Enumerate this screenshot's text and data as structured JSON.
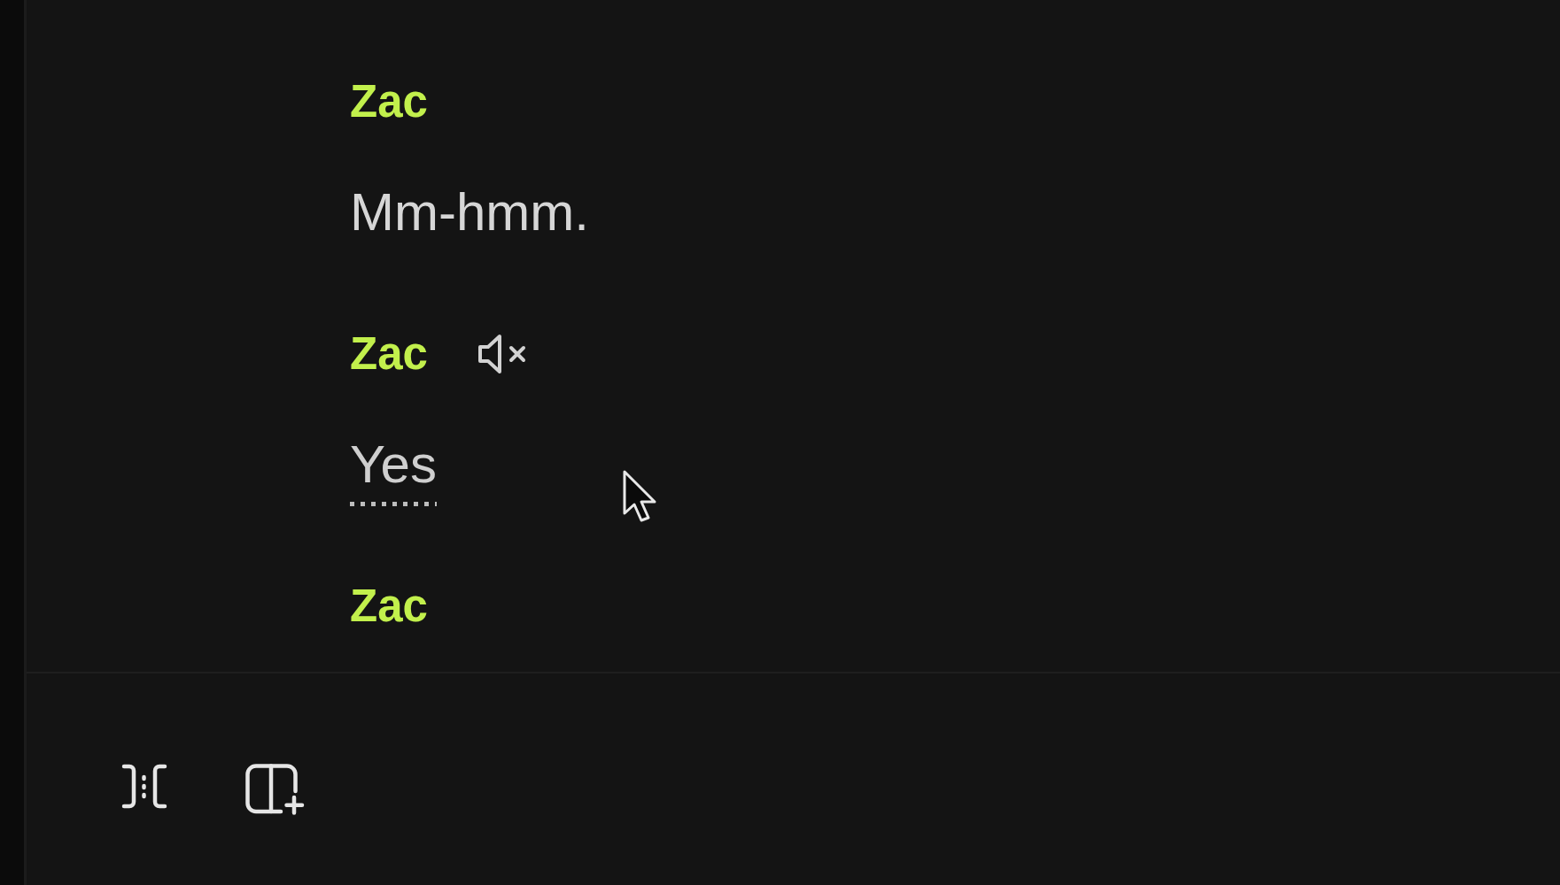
{
  "transcript": [
    {
      "speaker": "Zac",
      "muted": false,
      "text": "Mm-hmm.",
      "flagged": false
    },
    {
      "speaker": "Zac",
      "muted": true,
      "text": "Yes",
      "flagged": true
    },
    {
      "speaker": "Zac",
      "muted": false
    }
  ]
}
